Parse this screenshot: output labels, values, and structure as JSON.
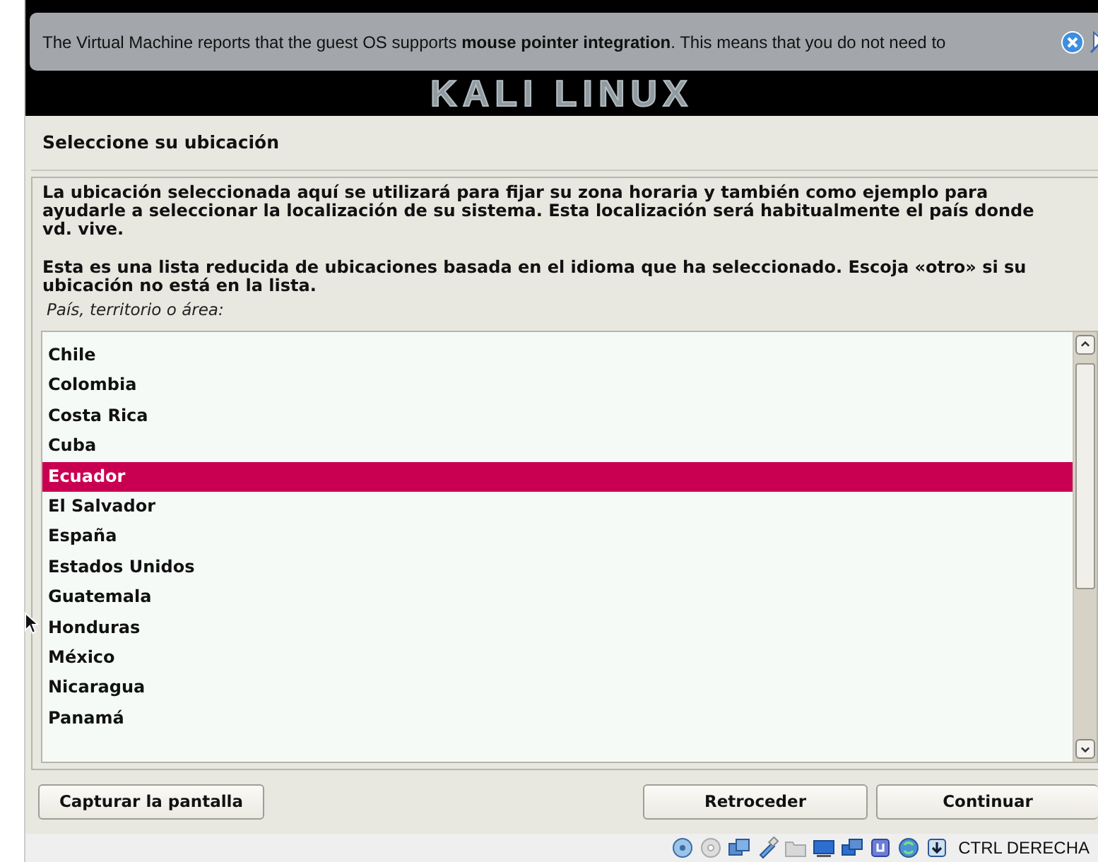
{
  "banner": {
    "logo": "KALI LINUX"
  },
  "notification": {
    "text": "The Virtual Machine reports that the guest OS supports **mouse pointer integration**. This means that you do not need to"
  },
  "installer": {
    "title": "Seleccione su ubicación",
    "paragraphs": [
      "La ubicación seleccionada aquí se utilizará para fijar su zona horaria y también como ejemplo para ayudarle a seleccionar la localización de su sistema. Esta localización será habitualmente el país donde vd. vive.",
      "Esta es una lista reducida de ubicaciones basada en el idioma que ha seleccionado. Escoja «otro» si su ubicación no está en la lista."
    ],
    "list_label": "País, territorio o área:",
    "items": [
      {
        "label": "Chile",
        "selected": false
      },
      {
        "label": "Colombia",
        "selected": false
      },
      {
        "label": "Costa Rica",
        "selected": false
      },
      {
        "label": "Cuba",
        "selected": false
      },
      {
        "label": "Ecuador",
        "selected": true
      },
      {
        "label": "El Salvador",
        "selected": false
      },
      {
        "label": "España",
        "selected": false
      },
      {
        "label": "Estados Unidos",
        "selected": false
      },
      {
        "label": "Guatemala",
        "selected": false
      },
      {
        "label": "Honduras",
        "selected": false
      },
      {
        "label": "México",
        "selected": false
      },
      {
        "label": "Nicaragua",
        "selected": false
      },
      {
        "label": "Panamá",
        "selected": false
      }
    ],
    "buttons": {
      "left": "Capturar la pantalla",
      "back": "Retroceder",
      "continue": "Continuar"
    }
  },
  "status_bar": {
    "host_key": "CTRL DERECHA"
  }
}
